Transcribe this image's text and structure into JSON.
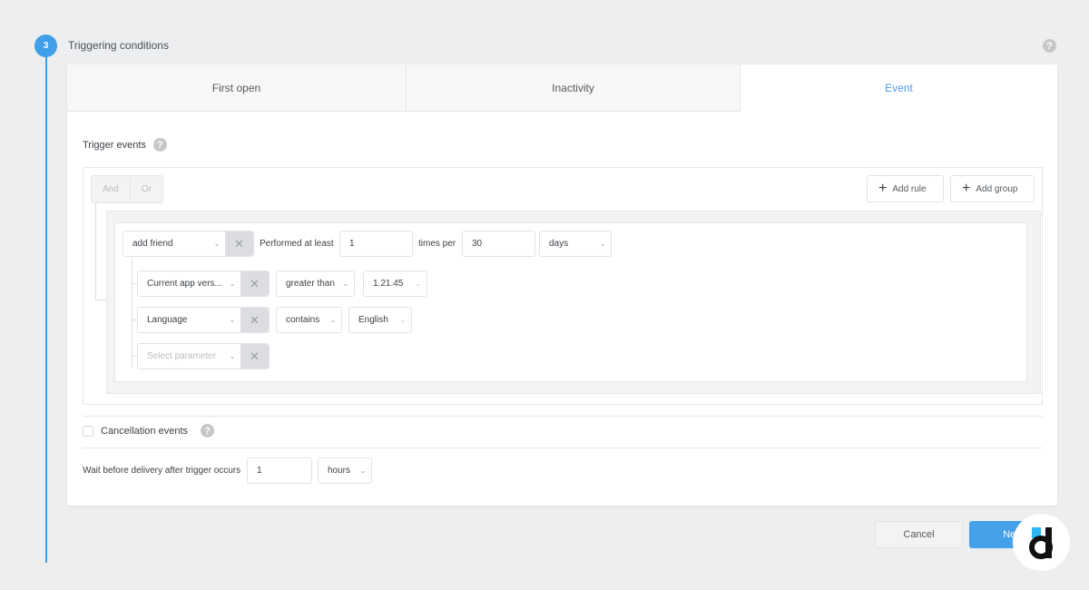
{
  "step": {
    "number": "3",
    "title": "Triggering conditions"
  },
  "tabs": [
    {
      "label": "First open",
      "active": false
    },
    {
      "label": "Inactivity",
      "active": false
    },
    {
      "label": "Event",
      "active": true
    }
  ],
  "trigger_events": {
    "label": "Trigger events",
    "logic": {
      "and_label": "And",
      "or_label": "Or"
    },
    "add_rule_label": "Add rule",
    "add_group_label": "Add group",
    "event_rule": {
      "event": "add friend",
      "performed_label": "Performed at least",
      "count": "1",
      "times_per_label": "times per",
      "period_value": "30",
      "period_unit": "days"
    },
    "params": [
      {
        "parameter": "Current app vers...",
        "operator": "greater than",
        "value": "1.21.45"
      },
      {
        "parameter": "Language",
        "operator": "contains",
        "value": "English"
      }
    ],
    "select_param_placeholder": "Select parameter"
  },
  "cancellation": {
    "label": "Cancellation events",
    "checked": false
  },
  "wait": {
    "label": "Wait before delivery after trigger occurs",
    "value": "1",
    "unit": "hours"
  },
  "footer": {
    "cancel_label": "Cancel",
    "next_label": "Next"
  },
  "colors": {
    "accent": "#3f9fe8",
    "active_tab_text": "#4a9be3",
    "next_button": "#45a1ea"
  }
}
